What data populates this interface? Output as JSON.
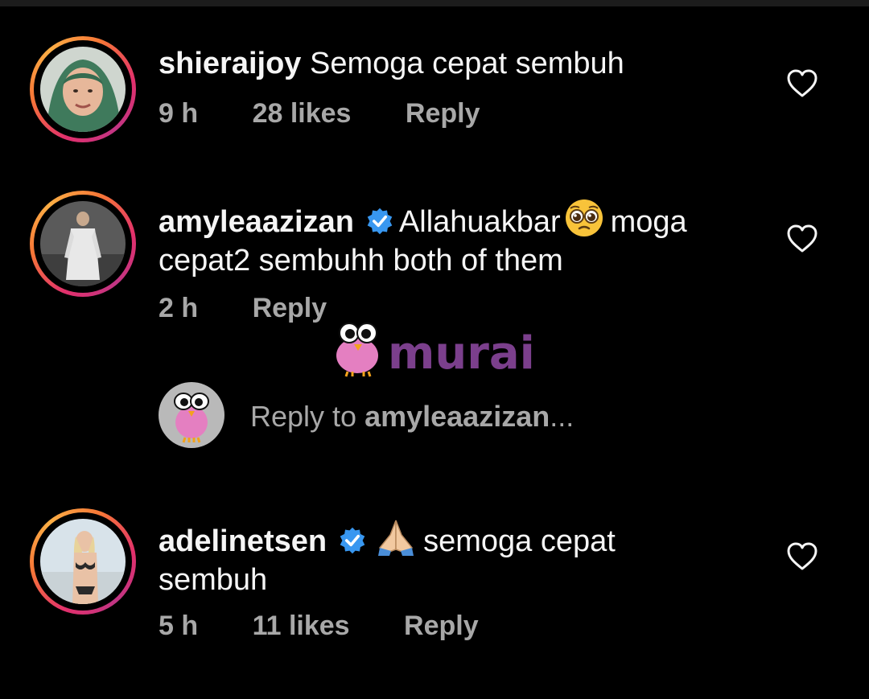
{
  "comments": [
    {
      "username": "shieraijoy",
      "verified": false,
      "text": "Semoga cepat sembuh",
      "time": "9 h",
      "likes": "28 likes",
      "reply_label": "Reply"
    },
    {
      "username": "amyleaazizan",
      "verified": true,
      "emoji": "pleading-face-emoji",
      "text_before_emoji": "Allahuakbar",
      "text_after_emoji": "moga",
      "text_line2": "cepat2 sembuhh both of them",
      "time": "2 h",
      "reply_label": "Reply"
    },
    {
      "username": "adelinetsen",
      "verified": true,
      "emoji": "folded-hands-emoji",
      "text": "semoga cepat",
      "text_line2": "sembuh",
      "time": "5 h",
      "likes": "11 likes",
      "reply_label": "Reply"
    }
  ],
  "reply_input": {
    "prefix": "Reply to ",
    "target": "amyleaazizan",
    "suffix": "..."
  },
  "watermark": {
    "text": "murai",
    "color": "#7b3f8c"
  },
  "icons": {
    "like": "heart-outline-icon",
    "verified": "verified-badge-icon"
  },
  "colors": {
    "background": "#000000",
    "text": "#f5f5f5",
    "meta": "#a8a8a8",
    "verified": "#3897f0"
  }
}
